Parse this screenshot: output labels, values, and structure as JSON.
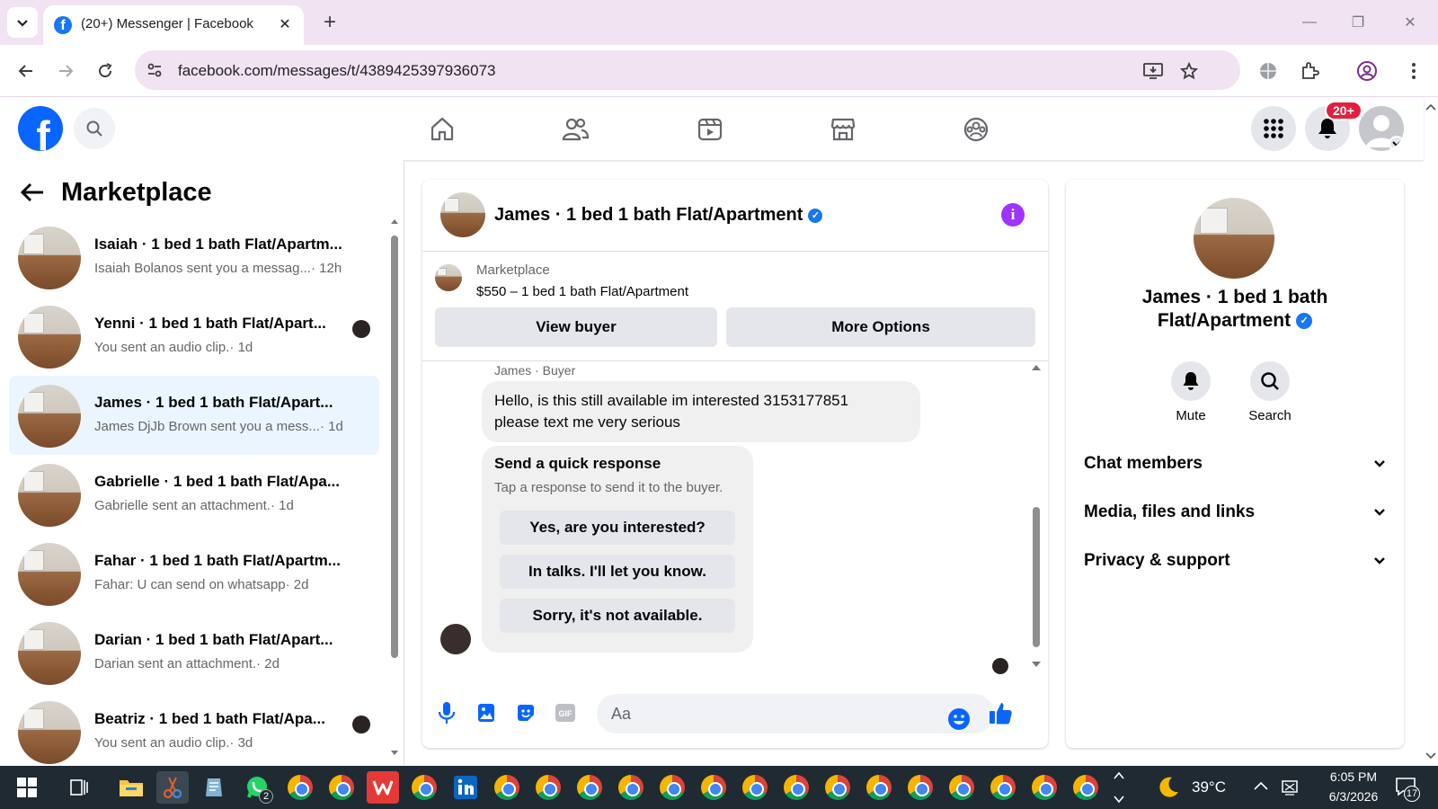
{
  "browser": {
    "tab_title": "(20+) Messenger | Facebook",
    "url": "facebook.com/messages/t/4389425397936073"
  },
  "header": {
    "notifications_badge": "20+"
  },
  "sidebar": {
    "title": "Marketplace",
    "conversations": [
      {
        "name": "Isaiah · 1 bed 1 bath Flat/Apartm...",
        "preview": "Isaiah Bolanos sent you a messag...",
        "time": "· 12h",
        "active": false,
        "seen": false
      },
      {
        "name": "Yenni · 1 bed 1 bath Flat/Apart...",
        "preview": "You sent an audio clip.",
        "time": "· 1d",
        "active": false,
        "seen": true
      },
      {
        "name": "James · 1 bed 1 bath Flat/Apart...",
        "preview": "James DjJb Brown sent you a mess...",
        "time": "· 1d",
        "active": true,
        "seen": false
      },
      {
        "name": "Gabrielle · 1 bed 1 bath Flat/Apa...",
        "preview": "Gabrielle sent an attachment.",
        "time": "· 1d",
        "active": false,
        "seen": false
      },
      {
        "name": "Fahar · 1 bed 1 bath Flat/Apartm...",
        "preview": "Fahar: U can send on whatsapp",
        "time": "· 2d",
        "active": false,
        "seen": false
      },
      {
        "name": "Darian · 1 bed 1 bath Flat/Apart...",
        "preview": "Darian sent an attachment.",
        "time": "· 2d",
        "active": false,
        "seen": false
      },
      {
        "name": "Beatriz · 1 bed 1 bath Flat/Apa...",
        "preview": "You sent an audio clip.",
        "time": "· 3d",
        "active": false,
        "seen": true
      }
    ]
  },
  "chat": {
    "title": "James · 1 bed 1 bath Flat/Apartment",
    "listing_source": "Marketplace",
    "listing": "$550 – 1 bed 1 bath Flat/Apartment",
    "view_buyer": "View buyer",
    "more_options": "More Options",
    "sender_label": "James · Buyer",
    "message_line1": "Hello, is this still available im interested 3153177851",
    "message_line2": "please text me very serious",
    "quick_title": "Send a quick response",
    "quick_subtitle": "Tap a response to send it to the buyer.",
    "quick_replies": [
      "Yes, are you interested?",
      "In talks. I'll let you know.",
      "Sorry, it's not available."
    ],
    "input_placeholder": "Aa"
  },
  "info": {
    "name_line1": "James · 1 bed 1 bath",
    "name_line2": "Flat/Apartment",
    "mute": "Mute",
    "search": "Search",
    "sections": [
      "Chat members",
      "Media, files and links",
      "Privacy & support"
    ]
  },
  "taskbar": {
    "whatsapp_badge": "2",
    "temperature": "39°C",
    "time": "6:05 PM",
    "date": "6/3/2026",
    "notification_count": "17"
  },
  "colors": {
    "fb_blue": "#0866ff",
    "active_conv": "#ebf5ff",
    "info_purple": "#a033ff",
    "badge_red": "#e41e3f"
  }
}
